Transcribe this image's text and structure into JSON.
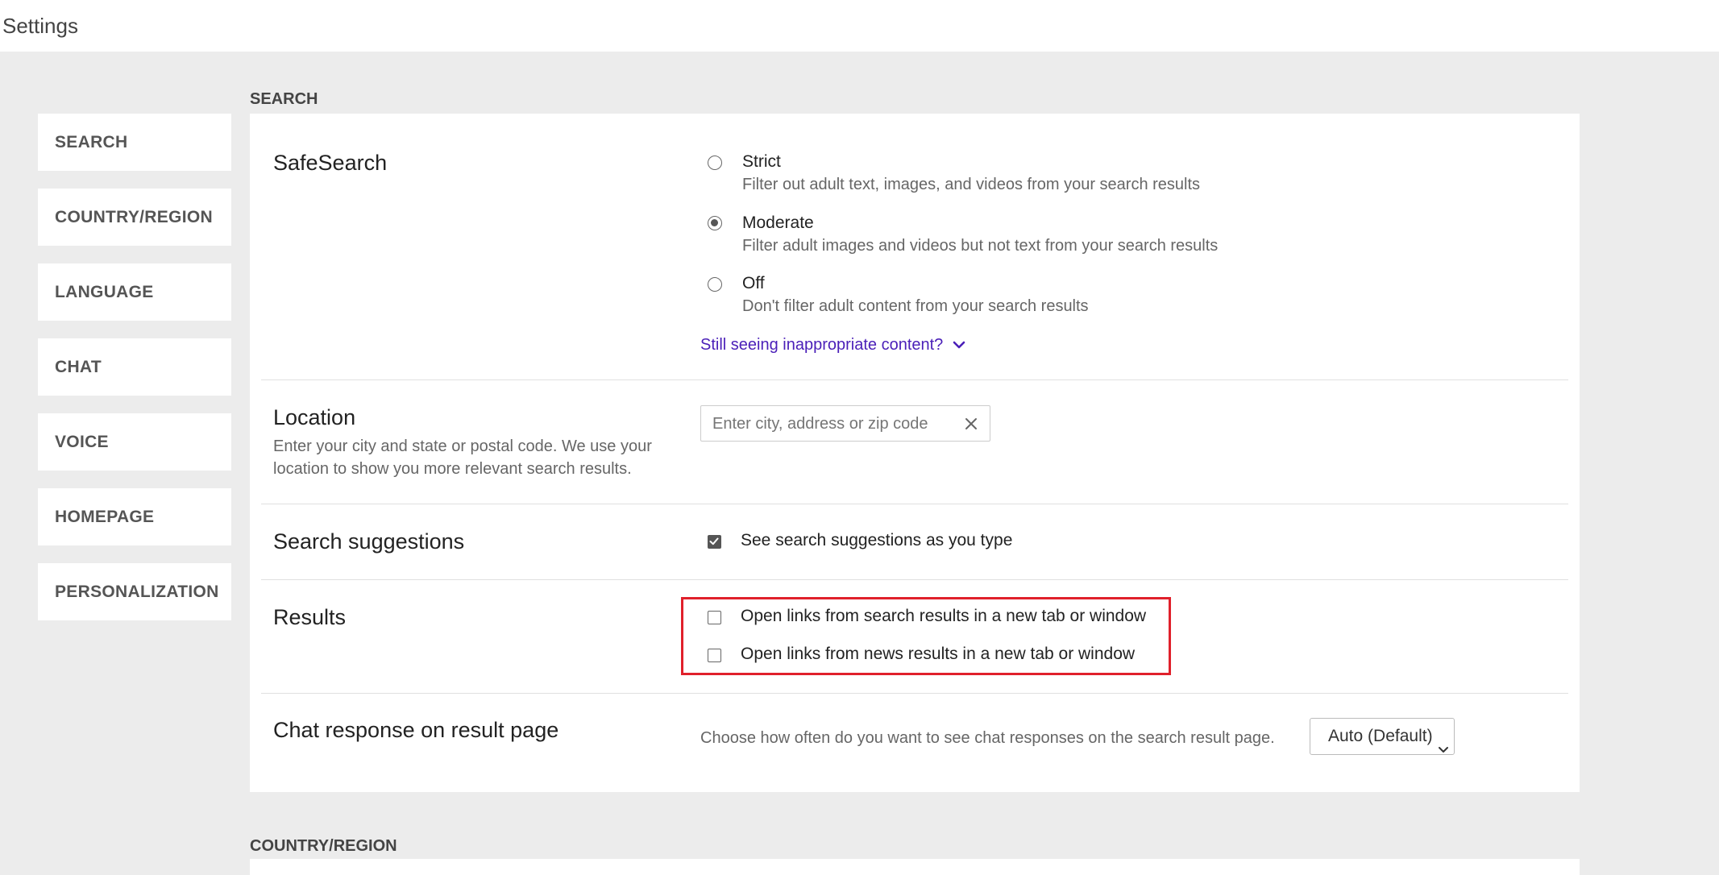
{
  "window": {
    "title": "Settings"
  },
  "nav": {
    "items": [
      {
        "label": "SEARCH"
      },
      {
        "label": "COUNTRY/REGION"
      },
      {
        "label": "LANGUAGE"
      },
      {
        "label": "CHAT"
      },
      {
        "label": "VOICE"
      },
      {
        "label": "HOMEPAGE"
      },
      {
        "label": "PERSONALIZATION"
      }
    ]
  },
  "search_section": {
    "heading": "SEARCH",
    "safesearch": {
      "label": "SafeSearch",
      "options": [
        {
          "title": "Strict",
          "description": "Filter out adult text, images, and videos from your search results",
          "selected": false
        },
        {
          "title": "Moderate",
          "description": "Filter adult images and videos but not text from your search results",
          "selected": true
        },
        {
          "title": "Off",
          "description": "Don't filter adult content from your search results",
          "selected": false
        }
      ],
      "more_link": "Still seeing inappropriate content?"
    },
    "location": {
      "label": "Location",
      "description": "Enter your city and state or postal code. We use your location to show you more relevant search results.",
      "input_value": "",
      "input_placeholder": "Enter city, address or zip code"
    },
    "suggestions": {
      "label": "Search suggestions",
      "checkbox_label": "See search suggestions as you type",
      "checked": true
    },
    "results": {
      "label": "Results",
      "options": [
        {
          "label": "Open links from search results in a new tab or window",
          "checked": false
        },
        {
          "label": "Open links from news results in a new tab or window",
          "checked": false
        }
      ]
    },
    "chat_response": {
      "label": "Chat response on result page",
      "description": "Choose how often do you want to see chat responses on the search result page.",
      "selected_value": "Auto (Default)"
    }
  },
  "country_section": {
    "heading": "COUNTRY/REGION"
  },
  "colors": {
    "link": "#4a1fb8",
    "highlight": "#e0202b",
    "page_bg": "#ececec"
  }
}
